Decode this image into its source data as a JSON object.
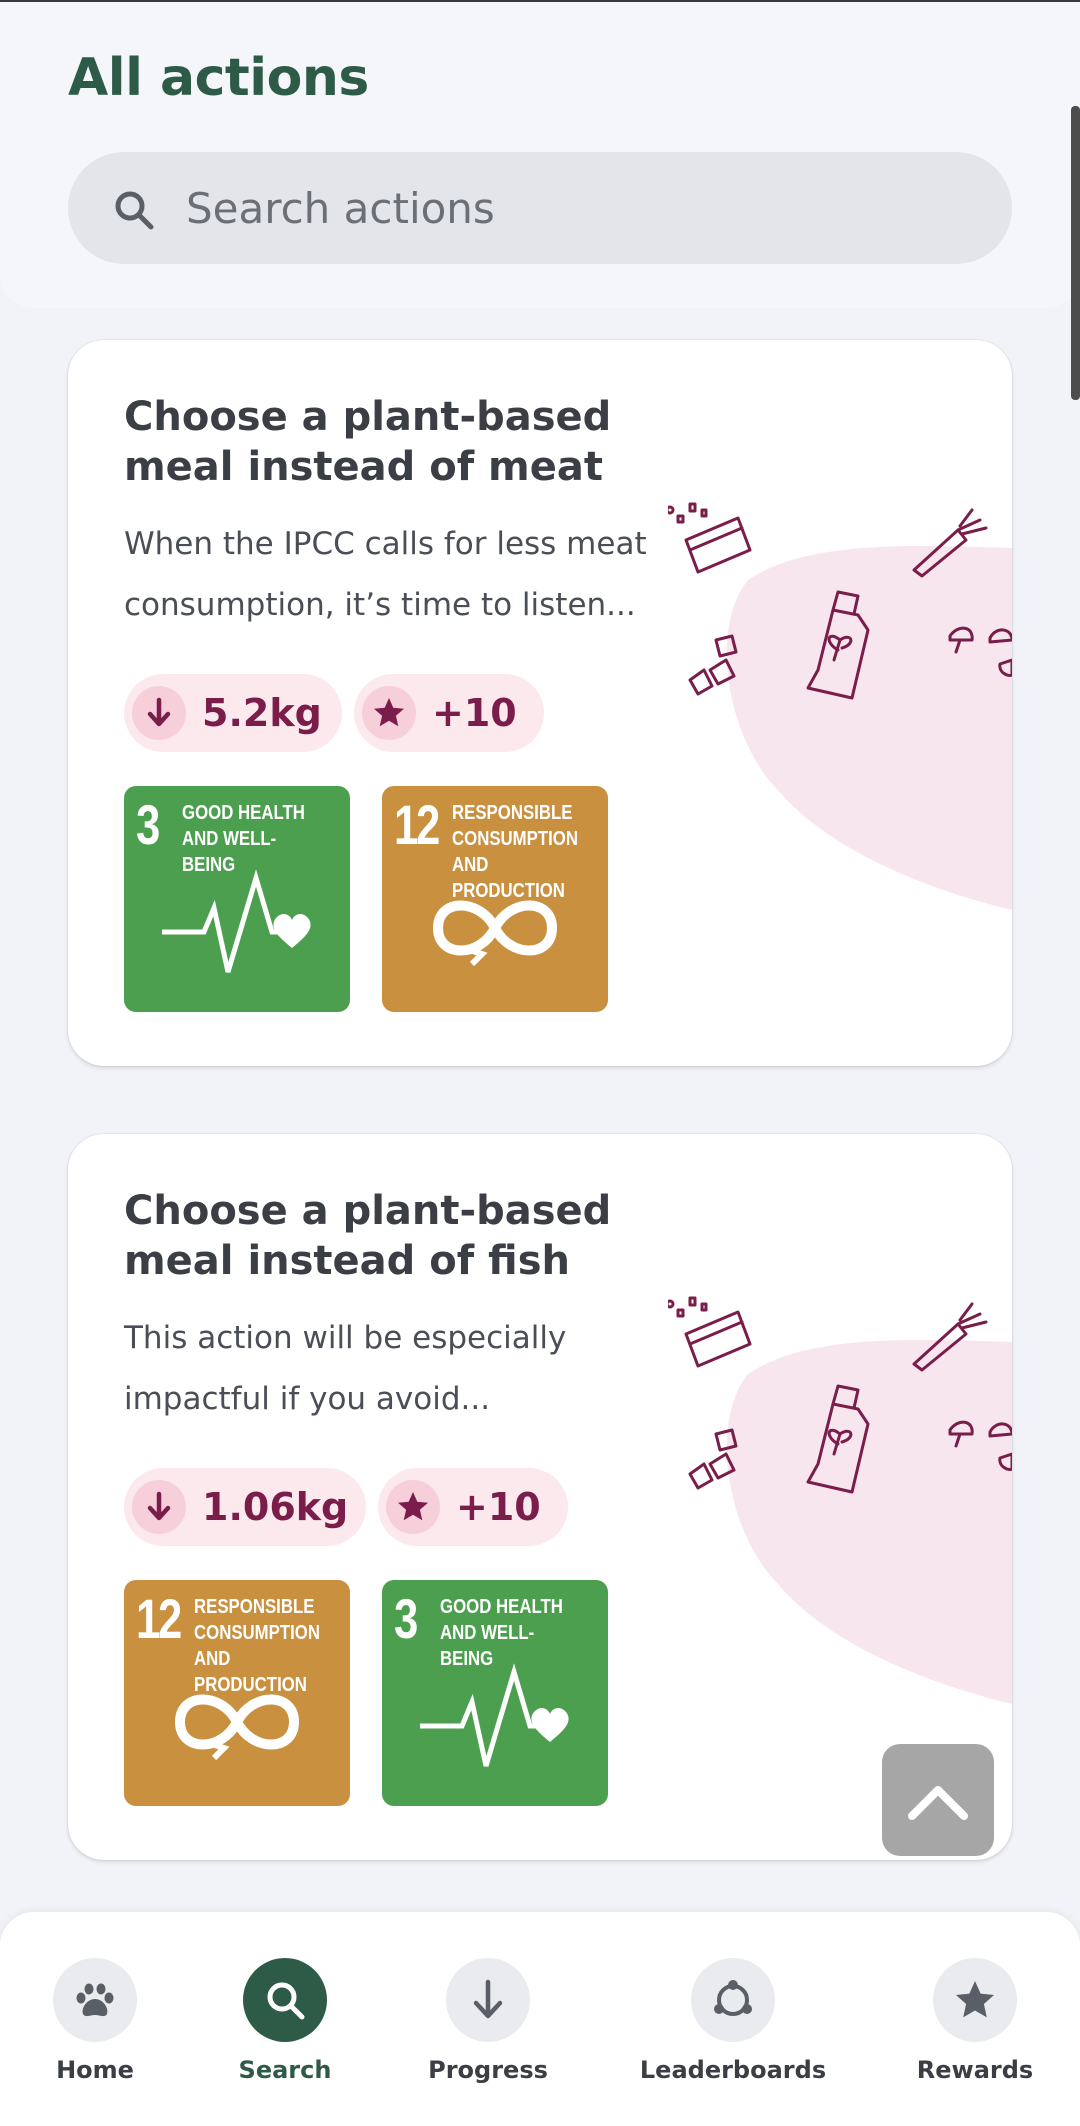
{
  "header": {
    "title": "All actions",
    "search": {
      "placeholder": "Search actions",
      "value": "",
      "icon": "search-icon"
    }
  },
  "actions": [
    {
      "title": "Choose a plant-based meal instead of meat",
      "description": "When the IPCC calls for less meat consumption, it’s time to listen...",
      "co2_reduction": "5.2kg",
      "points": "+10",
      "sdgs": [
        {
          "number": "3",
          "label": "Good Health and Well-Being",
          "color": "#4c9f4f",
          "icon": "heartbeat-icon"
        },
        {
          "number": "12",
          "label": "Responsible Consumption and Production",
          "color": "#c8903f",
          "icon": "infinity-icon"
        }
      ]
    },
    {
      "title": "Choose a plant-based meal instead of fish",
      "description": "This action will be especially impactful if you avoid...",
      "co2_reduction": "1.06kg",
      "points": "+10",
      "sdgs": [
        {
          "number": "12",
          "label": "Responsible Consumption and Production",
          "color": "#c8903f",
          "icon": "infinity-icon"
        },
        {
          "number": "3",
          "label": "Good Health and Well-Being",
          "color": "#4c9f4f",
          "icon": "heartbeat-icon"
        }
      ]
    }
  ],
  "bottom_nav": {
    "items": [
      {
        "label": "Home",
        "icon": "paw-icon",
        "active": false
      },
      {
        "label": "Search",
        "icon": "search-icon",
        "active": true
      },
      {
        "label": "Progress",
        "icon": "arrow-down-icon",
        "active": false
      },
      {
        "label": "Leaderboards",
        "icon": "group-icon",
        "active": false
      },
      {
        "label": "Rewards",
        "icon": "star-icon",
        "active": false
      }
    ]
  },
  "colors": {
    "brand": "#2e5b48",
    "chip_background": "#fbe9ee",
    "chip_text": "#7a1d4a",
    "sdg3": "#4c9f4f",
    "sdg12": "#c8903f"
  }
}
